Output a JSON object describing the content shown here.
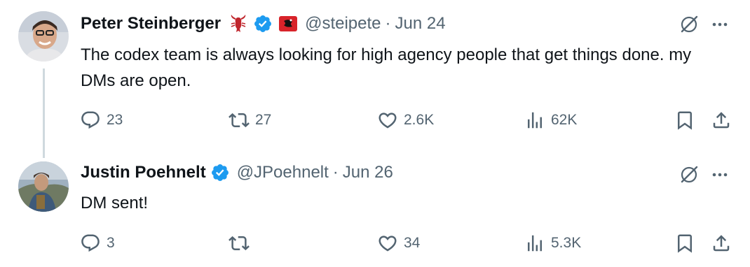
{
  "tweets": [
    {
      "author_name": "Peter Steinberger",
      "handle": "@steipete",
      "separator": "·",
      "date": "Jun 24",
      "text": "The codex team is always looking for high agency people that get things done. my DMs are open.",
      "badges": [
        "lobster-emoji-icon",
        "verified-badge-icon",
        "affiliate-flag-icon"
      ],
      "stats": {
        "replies": "23",
        "retweets": "27",
        "likes": "2.6K",
        "views": "62K"
      }
    },
    {
      "author_name": "Justin Poehnelt",
      "handle": "@JPoehnelt",
      "separator": "·",
      "date": "Jun 26",
      "text": "DM sent!",
      "badges": [
        "verified-badge-icon"
      ],
      "stats": {
        "replies": "3",
        "retweets": "",
        "likes": "34",
        "views": "5.3K"
      }
    }
  ],
  "colors": {
    "text": "#0f1419",
    "secondary": "#536471",
    "verified": "#1d9bf0",
    "thread_line": "#cfd9de"
  }
}
